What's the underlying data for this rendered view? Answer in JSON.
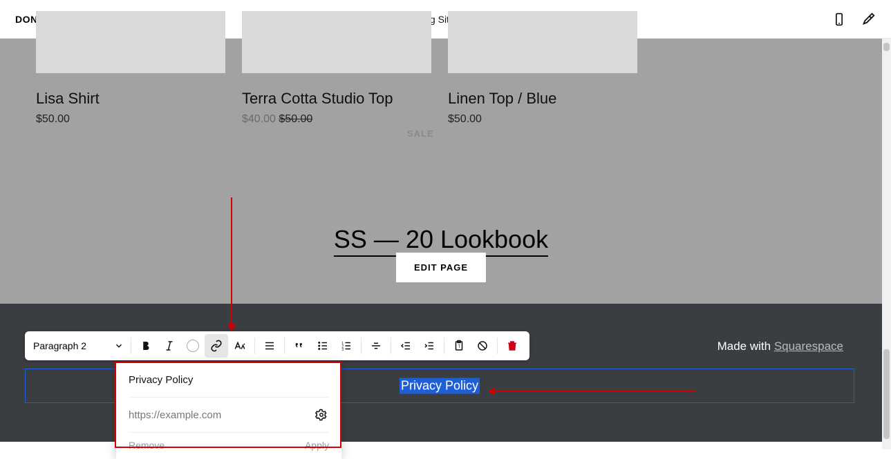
{
  "topbar": {
    "done_label": "DONE",
    "title": "Editing Site Footer"
  },
  "products": [
    {
      "title": "Lisa Shirt",
      "price": "$50.00"
    },
    {
      "title": "Terra Cotta Studio Top",
      "sale_price": "$40.00",
      "original_price": "$50.00"
    },
    {
      "title": "Linen Top / Blue",
      "price": "$50.00"
    }
  ],
  "sale_badge": "SALE",
  "lookbook": {
    "label": "SS — 20 Lookbook"
  },
  "edit_page_label": "EDIT PAGE",
  "rte": {
    "style_label": "Paragraph 2"
  },
  "made_with": {
    "prefix": "Made with ",
    "link": "Squarespace"
  },
  "footer_block": {
    "selected_text": "Privacy Policy"
  },
  "link_popover": {
    "title": "Privacy Policy",
    "url": "https://example.com",
    "remove_label": "Remove",
    "apply_label": "Apply"
  }
}
